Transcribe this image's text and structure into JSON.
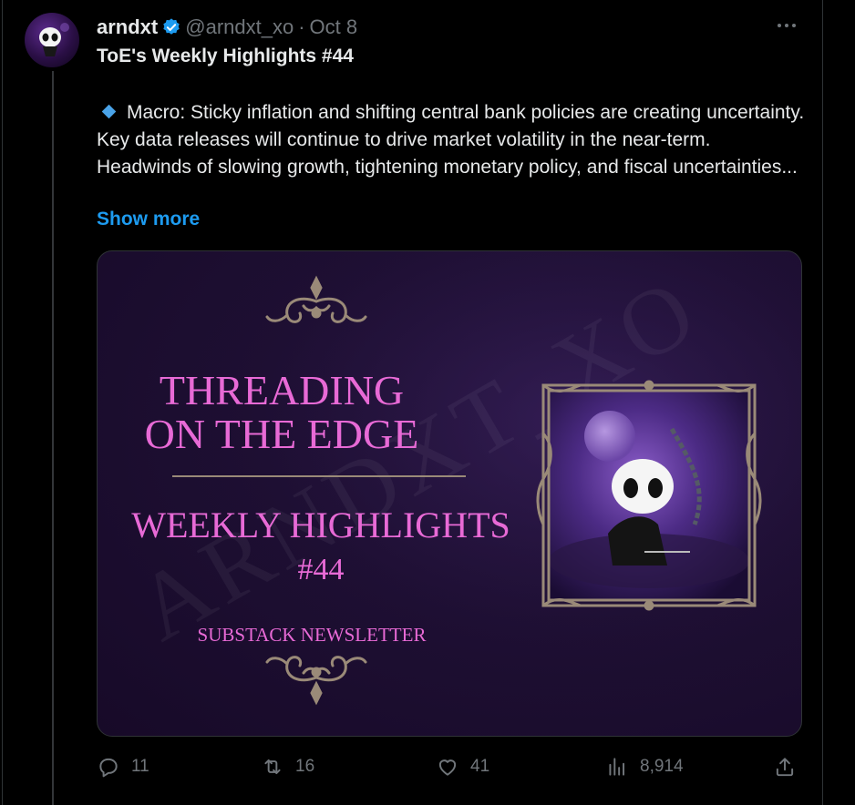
{
  "tweet": {
    "author_name": "arndxt",
    "handle": "@arndxt_xo",
    "separator": "·",
    "date": "Oct 8",
    "title": "ToE's Weekly Highlights #44",
    "body": "Macro: Sticky inflation and shifting central bank policies are creating uncertainty. Key data releases will continue to drive market volatility in the near-term. Headwinds of slowing growth, tightening monetary policy, and fiscal uncertainties...",
    "show_more": "Show more"
  },
  "media": {
    "title_line1": "THREADING",
    "title_line2": "ON THE EDGE",
    "subtitle_line1": "WEEKLY HIGHLIGHTS",
    "subtitle_line2": "#44",
    "tagline": "SUBSTACK NEWSLETTER",
    "watermark": "ARNDXT_XO"
  },
  "actions": {
    "replies": "11",
    "reposts": "16",
    "likes": "41",
    "views": "8,914"
  },
  "icons": [
    "verified-icon",
    "more-icon",
    "reply-icon",
    "repost-icon",
    "like-icon",
    "views-icon",
    "share-icon"
  ],
  "colors": {
    "background": "#000000",
    "text": "#e7e9ea",
    "muted": "#71767b",
    "link": "#1d9bf0",
    "media_pink": "#e86ad6",
    "ornament": "#9a8a78"
  }
}
